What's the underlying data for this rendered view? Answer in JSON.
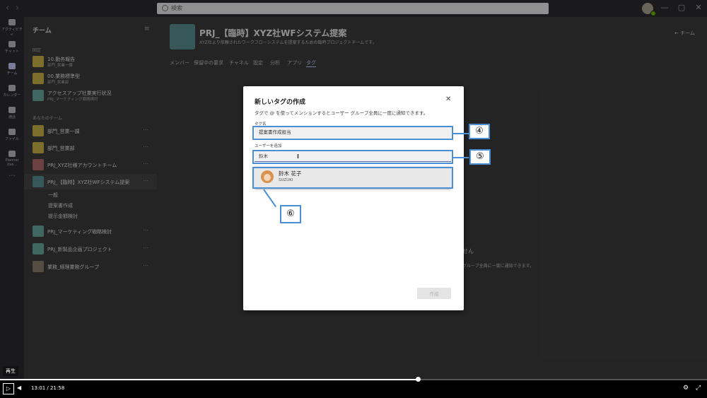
{
  "titlebar": {
    "back_glyph": "‹",
    "forward_glyph": "›",
    "search_placeholder": "検索",
    "win_min": "—",
    "win_max": "▢",
    "win_close": "✕"
  },
  "rail": [
    {
      "label": "アクティビティ"
    },
    {
      "label": "チャット"
    },
    {
      "label": "チーム"
    },
    {
      "label": "カレンダー"
    },
    {
      "label": "通話"
    },
    {
      "label": "ファイル"
    },
    {
      "label": "Planner (tas..."
    },
    {
      "label": "…"
    }
  ],
  "teampanel": {
    "title": "チーム",
    "filter_glyph": "≡",
    "section_pinned": "固定",
    "section_mine": "あなたのチーム",
    "more_glyph": "⋯",
    "pinned": [
      {
        "name": "10.勤务報告",
        "sub": "部門_営業一課"
      },
      {
        "name": "00.業務標準型",
        "sub": "部門_営業部"
      },
      {
        "name": "アクセスアップ社業実行状況",
        "sub": "PRJ_マーケティング戦略検討"
      }
    ],
    "teams": [
      {
        "name": "部門_営業一課"
      },
      {
        "name": "部門_営業部"
      },
      {
        "name": "PRJ_XYZ社様アカウントチーム"
      },
      {
        "name": "PRJ_【臨時】XYZ社WFシステム提案"
      },
      {
        "name": "PRJ_マーケティング戦略検討"
      },
      {
        "name": "PRJ_新製品企画プロジェクト"
      },
      {
        "name": "業務_経理業務グループ"
      }
    ],
    "channels": [
      "一般",
      "提案書作成",
      "提示金額検討"
    ]
  },
  "main": {
    "team_title": "PRJ_【臨時】XYZ社WFシステム提案",
    "team_more": "⋯",
    "team_desc": "XYZ社より依頼されたワークフローシステムを提案するための臨時プロジェクトチームです。",
    "team_button": "← チーム",
    "tabs": [
      "メンバー",
      "保留中の要求",
      "チャネル",
      "設定",
      "分析",
      "アプリ",
      "タグ"
    ],
    "bg_text_1": "せん",
    "bg_text_2": "グループ全員に一度に通知できます。"
  },
  "dialog": {
    "title": "新しいタグの作成",
    "close_glyph": "✕",
    "description": "タグで @ を使ってメンションするとユーザー グループ全員に一度に通知できます。",
    "tag_name_label": "タグ名",
    "tag_name_value": "提案書作成担当",
    "add_user_label": "ユーザーを追加",
    "add_user_value": "鈴木",
    "ibeam_glyph": "I",
    "suggestion": {
      "name": "鈴木 花子",
      "sub": "SUZUKI"
    },
    "create_label": "作成"
  },
  "annotations": {
    "n4": "④",
    "n5": "⑤",
    "n6": "⑥"
  },
  "player": {
    "tooltip": "再生",
    "play_glyph": "▷",
    "volume_glyph": "◀",
    "timecode": "13:01  /  21:58",
    "settings_glyph": "⚙",
    "fullscreen_glyph": "⤢",
    "progress_fraction": 0.592
  }
}
